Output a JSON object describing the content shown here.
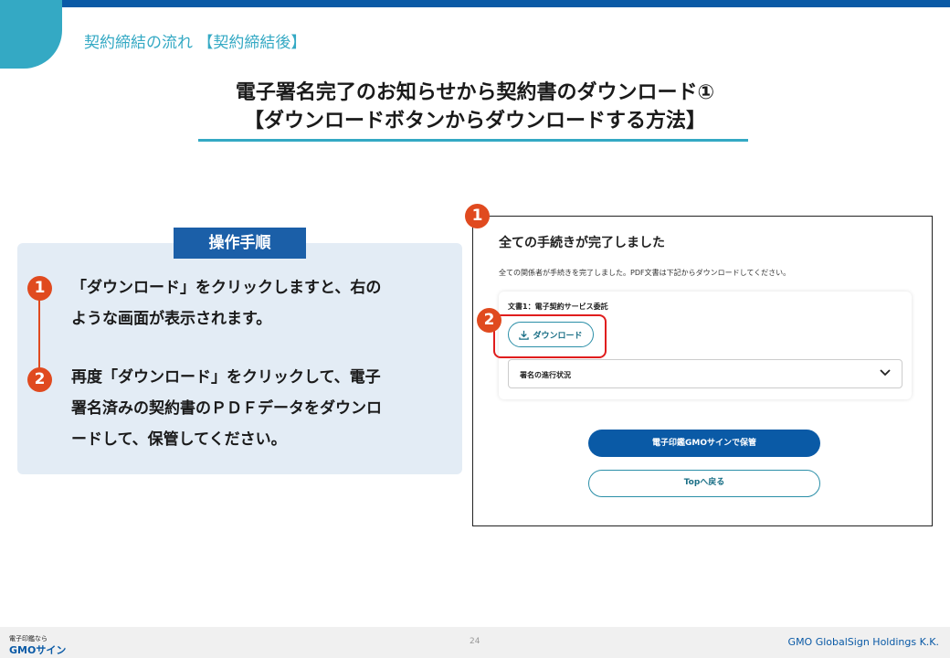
{
  "header": {
    "breadcrumb": "契約締結の流れ 【契約締結後】",
    "title_line1": "電子署名完了のお知らせから契約書のダウンロード①",
    "title_line2": "【ダウンロードボタンからダウンロードする方法】"
  },
  "instructions": {
    "heading": "操作手順",
    "steps": [
      {
        "number": "1",
        "text_line1": "「ダウンロード」をクリックしますと、右の",
        "text_line2": "ような画面が表示されます。"
      },
      {
        "number": "2",
        "text_line1": "再度「ダウンロード」をクリックして、電子",
        "text_line2": "署名済みの契約書のＰＤＦデータをダウンロ",
        "text_line3": "ードして、保管してください。"
      }
    ],
    "accent_color": "#e04a1f"
  },
  "screenshot": {
    "marker1": "1",
    "marker2": "2",
    "title": "全ての手続きが完了しました",
    "description": "全ての関係者が手続きを完了しました。PDF文書は下記からダウンロードしてください。",
    "document_label": "文書1：電子契約サービス委託",
    "download_button": "ダウンロード",
    "progress_label": "署名の進行状況",
    "save_button": "電子印鑑GMOサインで保管",
    "top_button": "Topへ戻る",
    "icons": [
      "download-icon",
      "chevron-down-icon"
    ]
  },
  "footer": {
    "logo_small": "電子印鑑なら",
    "logo_main": "GMOサイン",
    "page_number": "24",
    "company": "GMO GlobalSign Holdings K.K."
  },
  "colors": {
    "brand_blue": "#0a5aa6",
    "teal": "#34a9c4",
    "highlight_red": "#e01d1d"
  }
}
